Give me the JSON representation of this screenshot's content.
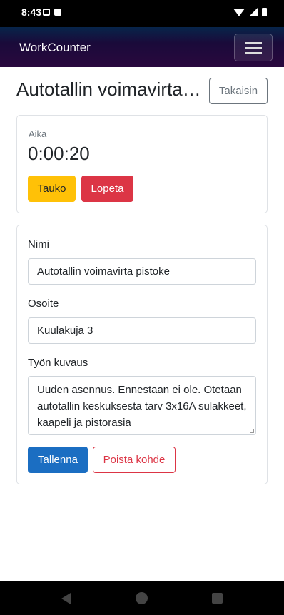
{
  "status_bar": {
    "time": "8:43"
  },
  "navbar": {
    "brand": "WorkCounter"
  },
  "header": {
    "title": "Autotallin voimavirta pistoke",
    "back_label": "Takaisin"
  },
  "timer": {
    "label": "Aika",
    "value": "0:00:20",
    "pause_label": "Tauko",
    "stop_label": "Lopeta"
  },
  "form": {
    "name_label": "Nimi",
    "name_value": "Autotallin voimavirta pistoke",
    "address_label": "Osoite",
    "address_value": "Kuulakuja 3",
    "description_label": "Työn kuvaus",
    "description_value": "Uuden asennus. Ennestaan ei ole. Otetaan autotallin keskuksesta tarv 3x16A sulakkeet, kaapeli ja pistorasia",
    "save_label": "Tallenna",
    "delete_label": "Poista kohde"
  },
  "colors": {
    "warning": "#ffc107",
    "danger": "#dc3545",
    "primary": "#1b6ec2",
    "navbar": "#1a0a3a"
  }
}
